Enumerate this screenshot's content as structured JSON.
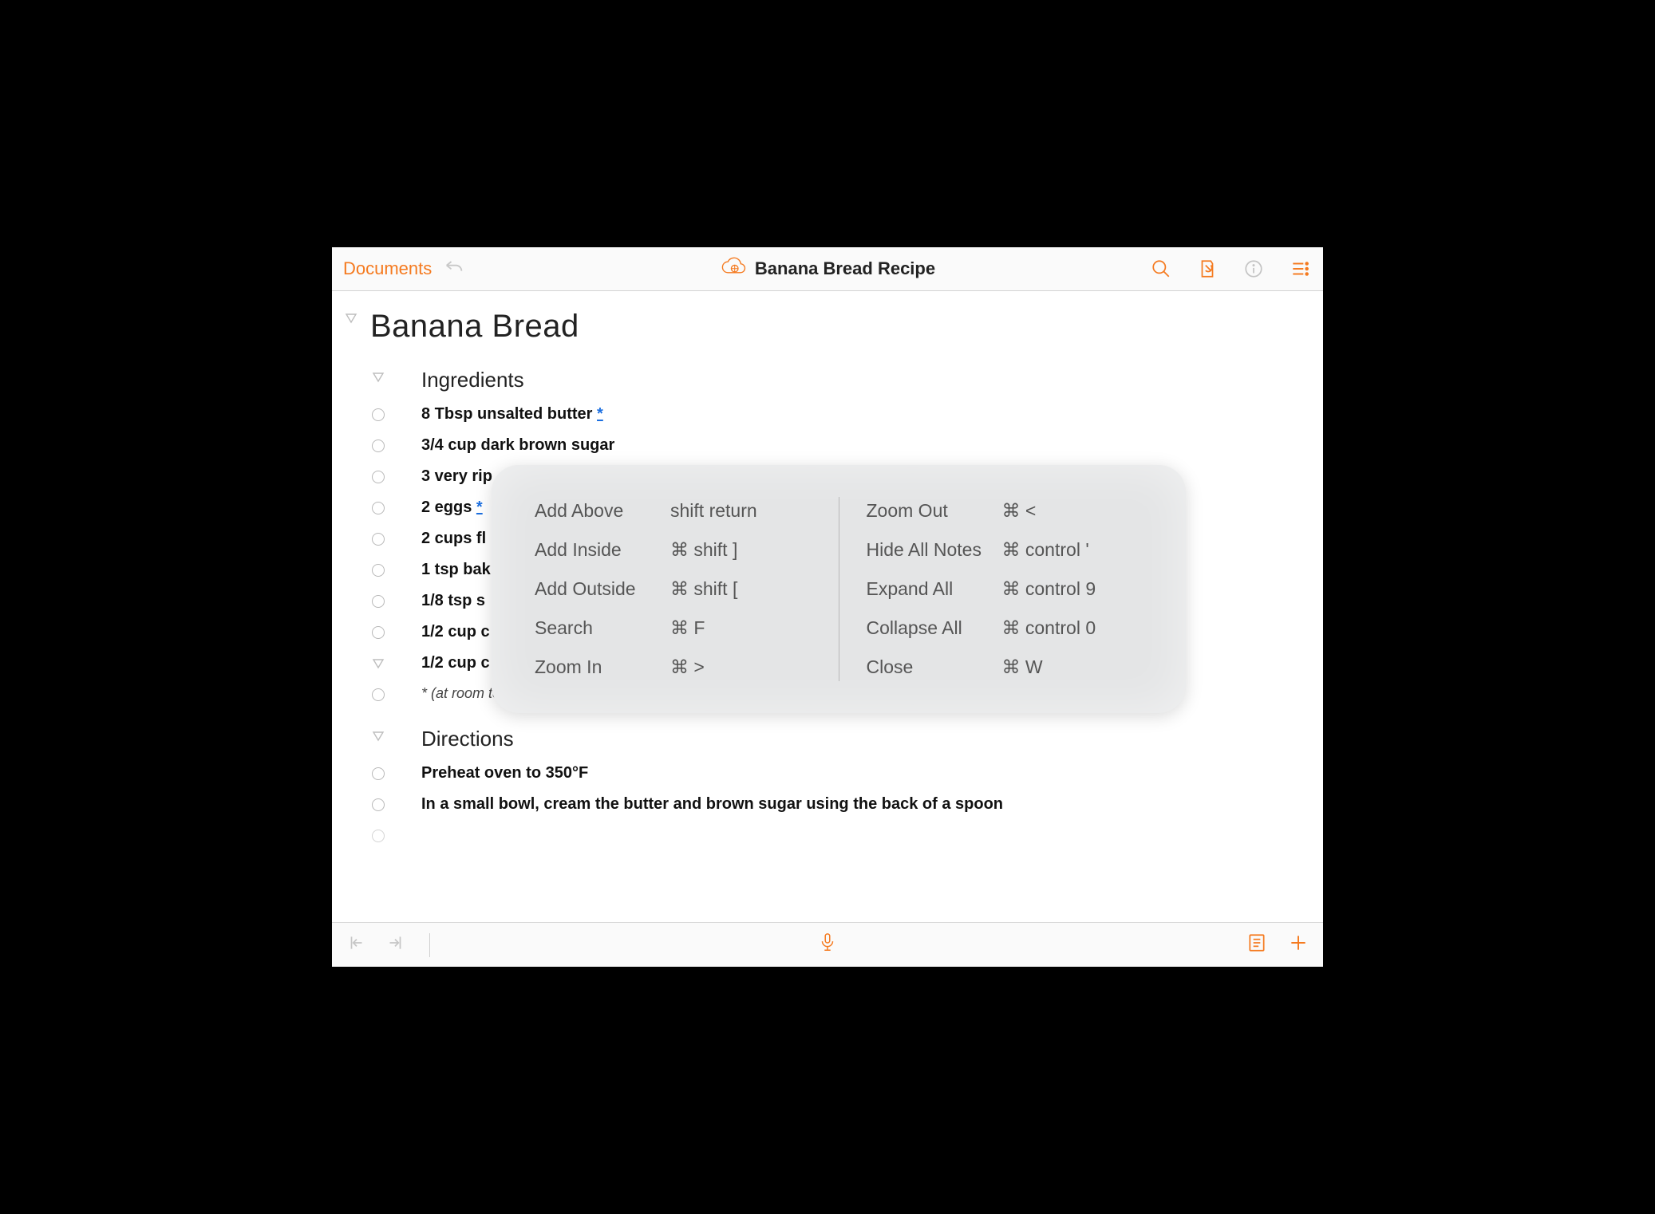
{
  "toolbar": {
    "documents_label": "Documents",
    "title": "Banana Bread Recipe"
  },
  "outline": {
    "title": "Banana Bread",
    "sections": [
      {
        "heading": "Ingredients",
        "items": [
          {
            "text": "8 Tbsp unsalted butter ",
            "asterisk": "*"
          },
          {
            "text": "3/4 cup dark brown sugar"
          },
          {
            "text": "3 very rip"
          },
          {
            "text": "2 eggs ",
            "asterisk": "*"
          },
          {
            "text": "2 cups fl"
          },
          {
            "text": "1 tsp bak"
          },
          {
            "text": "1/8 tsp s"
          },
          {
            "text": "1/2 cup c"
          },
          {
            "text": "1/2 cup c",
            "collapsible": true
          }
        ],
        "note": "* (at room temperature)"
      },
      {
        "heading": "Directions",
        "items": [
          {
            "text": "Preheat oven to 350°F"
          },
          {
            "text": "In a small bowl, cream the butter and brown sugar using the back of a spoon"
          }
        ]
      }
    ]
  },
  "shortcuts": {
    "left": [
      {
        "label": "Add Above",
        "keys": "shift return"
      },
      {
        "label": "Add Inside",
        "keys": "⌘  shift ]"
      },
      {
        "label": "Add Outside",
        "keys": "⌘  shift ["
      },
      {
        "label": "Search",
        "keys": "⌘  F"
      },
      {
        "label": "Zoom In",
        "keys": "⌘  >"
      }
    ],
    "right": [
      {
        "label": "Zoom Out",
        "keys": "⌘  <"
      },
      {
        "label": "Hide All Notes",
        "keys": "⌘  control '"
      },
      {
        "label": "Expand All",
        "keys": "⌘  control 9"
      },
      {
        "label": "Collapse All",
        "keys": "⌘  control 0"
      },
      {
        "label": "Close",
        "keys": "⌘  W"
      }
    ]
  }
}
